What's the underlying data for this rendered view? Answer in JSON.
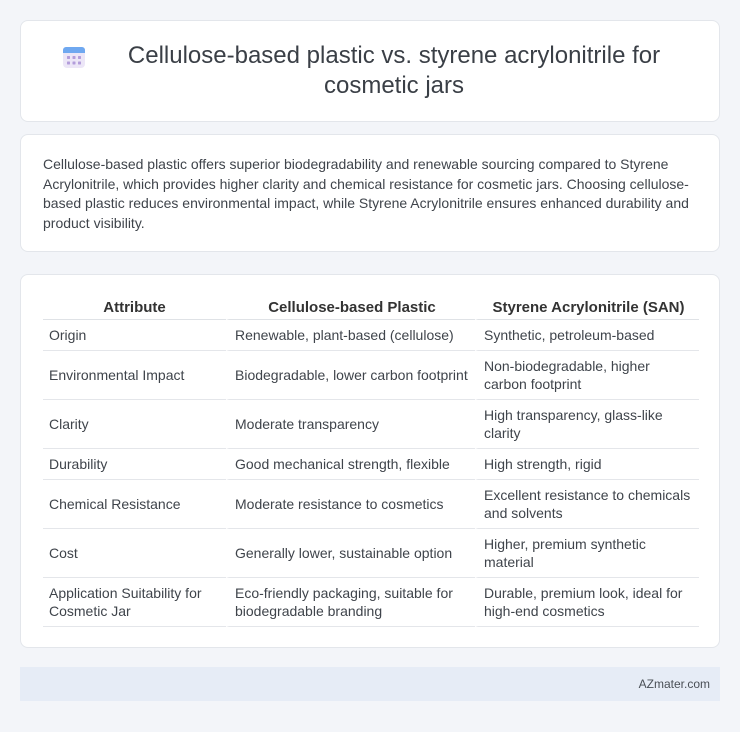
{
  "header": {
    "icon": "calendar-grid-icon",
    "title": "Cellulose-based plastic vs. styrene acrylonitrile for cosmetic jars"
  },
  "summary": {
    "text": "Cellulose-based plastic offers superior biodegradability and renewable sourcing compared to Styrene Acrylonitrile, which provides higher clarity and chemical resistance for cosmetic jars. Choosing cellulose-based plastic reduces environmental impact, while Styrene Acrylonitrile ensures enhanced durability and product visibility."
  },
  "table": {
    "headers": [
      "Attribute",
      "Cellulose-based Plastic",
      "Styrene Acrylonitrile (SAN)"
    ],
    "rows": [
      [
        "Origin",
        "Renewable, plant-based (cellulose)",
        "Synthetic, petroleum-based"
      ],
      [
        "Environmental Impact",
        "Biodegradable, lower carbon footprint",
        "Non-biodegradable, higher carbon footprint"
      ],
      [
        "Clarity",
        "Moderate transparency",
        "High transparency, glass-like clarity"
      ],
      [
        "Durability",
        "Good mechanical strength, flexible",
        "High strength, rigid"
      ],
      [
        "Chemical Resistance",
        "Moderate resistance to cosmetics",
        "Excellent resistance to chemicals and solvents"
      ],
      [
        "Cost",
        "Generally lower, sustainable option",
        "Higher, premium synthetic material"
      ],
      [
        "Application Suitability for Cosmetic Jar",
        "Eco-friendly packaging, suitable for biodegradable branding",
        "Durable, premium look, ideal for high-end cosmetics"
      ]
    ]
  },
  "footer": {
    "brand": "AZmater.com"
  }
}
